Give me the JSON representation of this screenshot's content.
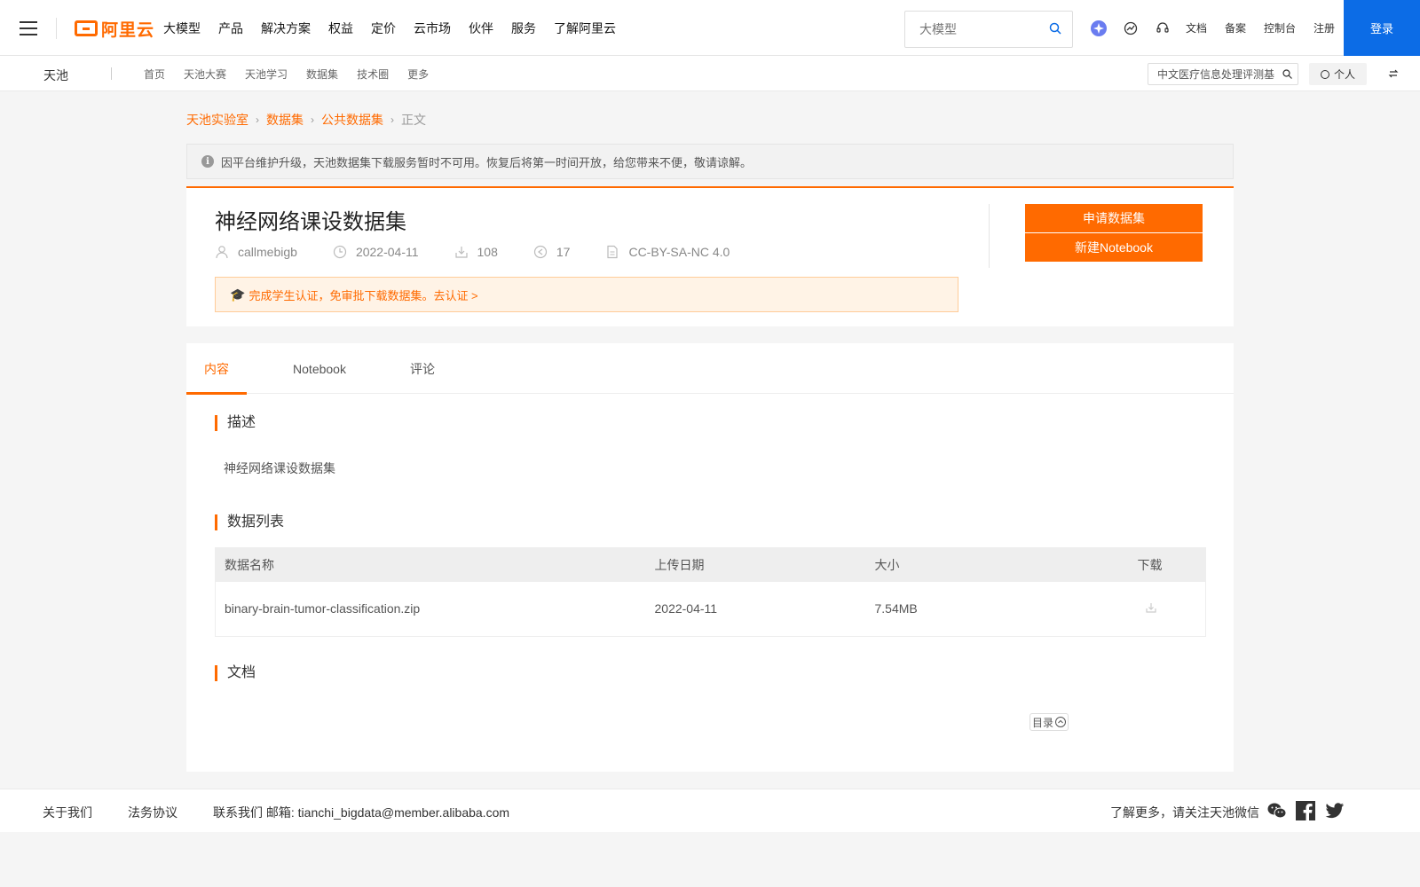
{
  "topbar": {
    "logo_text": "阿里云",
    "nav": [
      "大模型",
      "产品",
      "解决方案",
      "权益",
      "定价",
      "云市场",
      "伙伴",
      "服务",
      "了解阿里云"
    ],
    "search_placeholder": "大模型",
    "links": [
      "文档",
      "备案",
      "控制台",
      "注册"
    ],
    "login": "登录",
    "accent_color": "#ff6a00",
    "login_color": "#0c6ce6"
  },
  "subbar": {
    "brand": "天池",
    "nav": [
      "首页",
      "天池大赛",
      "天池学习",
      "数据集",
      "技术圈",
      "更多"
    ],
    "search_value": "中文医疗信息处理评测基",
    "personal": "个人"
  },
  "breadcrumb": [
    "天池实验室",
    "数据集",
    "公共数据集",
    "正文"
  ],
  "notice": "因平台维护升级，天池数据集下载服务暂时不可用。恢复后将第一时间开放，给您带来不便，敬请谅解。",
  "dataset": {
    "title": "神经网络课设数据集",
    "author": "callmebigb",
    "date": "2022-04-11",
    "downloads": "108",
    "shares": "17",
    "license": "CC-BY-SA-NC 4.0",
    "cert_text": "完成学生认证，免审批下载数据集。去认证 >",
    "apply_btn": "申请数据集",
    "notebook_btn": "新建Notebook"
  },
  "tabs": [
    "内容",
    "Notebook",
    "评论"
  ],
  "sections": {
    "desc_title": "描述",
    "desc_text": "神经网络课设数据集",
    "list_title": "数据列表",
    "doc_title": "文档"
  },
  "table": {
    "headers": [
      "数据名称",
      "上传日期",
      "大小",
      "下载"
    ],
    "rows": [
      {
        "name": "binary-brain-tumor-classification.zip",
        "date": "2022-04-11",
        "size": "7.54MB"
      }
    ]
  },
  "toc": "目录",
  "footer": {
    "about": "关于我们",
    "legal": "法务协议",
    "contact": "联系我们 邮箱: tianchi_bigdata@member.alibaba.com",
    "follow": "了解更多，请关注天池微信"
  }
}
